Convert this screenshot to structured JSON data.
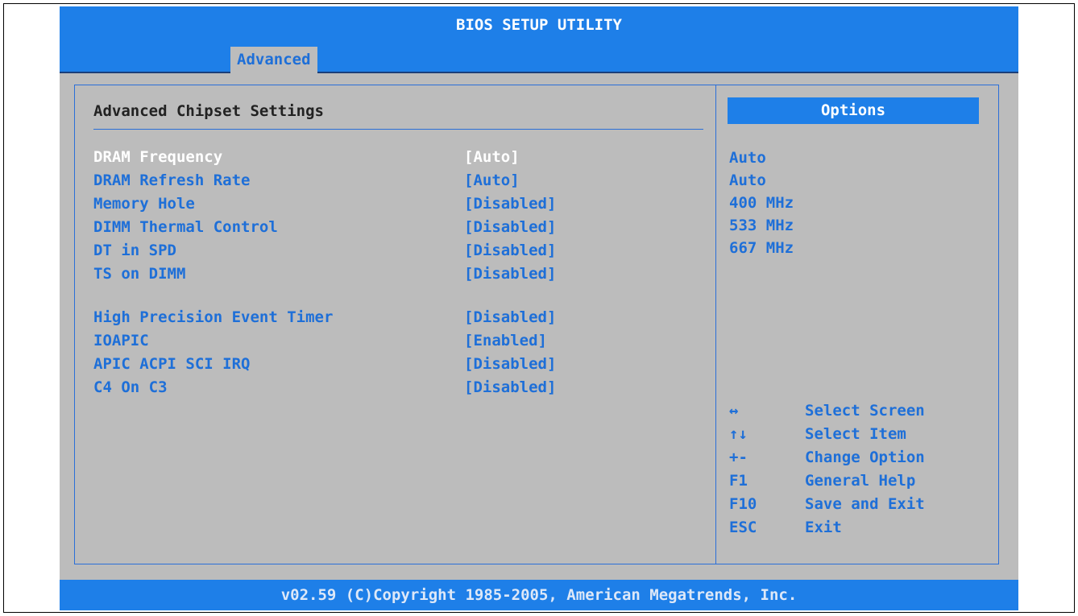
{
  "title": "BIOS SETUP UTILITY",
  "tabs": [
    {
      "label": "Advanced"
    }
  ],
  "section_title": "Advanced Chipset Settings",
  "settings": [
    {
      "name": "DRAM Frequency",
      "value": "[Auto]"
    },
    {
      "name": "DRAM Refresh Rate",
      "value": "[Auto]"
    },
    {
      "name": "Memory Hole",
      "value": "[Disabled]"
    },
    {
      "name": "DIMM Thermal Control",
      "value": "[Disabled]"
    },
    {
      "name": "DT in SPD",
      "value": "[Disabled]"
    },
    {
      "name": "TS on DIMM",
      "value": "[Disabled]"
    },
    {
      "name": "High Precision Event Timer",
      "value": "[Disabled]"
    },
    {
      "name": "IOAPIC",
      "value": "[Enabled]"
    },
    {
      "name": "APIC ACPI SCI IRQ",
      "value": "[Disabled]"
    },
    {
      "name": "C4 On C3",
      "value": "[Disabled]"
    }
  ],
  "options": {
    "header": "Options",
    "items": [
      "Auto",
      "Auto",
      "400 MHz",
      "533 MHz",
      "667 MHz"
    ]
  },
  "help": [
    {
      "key": "↔",
      "desc": "Select Screen"
    },
    {
      "key": "↑↓",
      "desc": "Select Item"
    },
    {
      "key": "+-",
      "desc": "Change Option"
    },
    {
      "key": "F1",
      "desc": "General Help"
    },
    {
      "key": "F10",
      "desc": "Save and Exit"
    },
    {
      "key": "ESC",
      "desc": "Exit"
    }
  ],
  "footer": "v02.59 (C)Copyright 1985-2005, American Megatrends, Inc.",
  "colors": {
    "accent": "#1e7fe8",
    "panel_bg": "#bcbcbc",
    "text_blue": "#1e6fd8",
    "selected_text": "#ffffff"
  }
}
